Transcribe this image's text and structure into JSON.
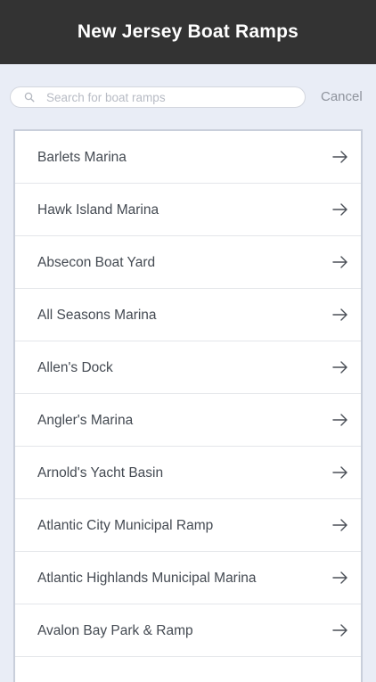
{
  "header": {
    "title": "New Jersey Boat Ramps"
  },
  "search": {
    "placeholder": "Search for boat ramps",
    "value": "",
    "cancel_label": "Cancel"
  },
  "list": {
    "items": [
      {
        "label": "Barlets Marina"
      },
      {
        "label": "Hawk Island Marina"
      },
      {
        "label": "Absecon Boat Yard"
      },
      {
        "label": "All Seasons Marina"
      },
      {
        "label": "Allen's Dock"
      },
      {
        "label": "Angler's Marina"
      },
      {
        "label": "Arnold's Yacht Basin"
      },
      {
        "label": "Atlantic City Municipal Ramp"
      },
      {
        "label": "Atlantic Highlands Municipal Marina"
      },
      {
        "label": "Avalon Bay Park & Ramp"
      },
      {
        "label": ""
      }
    ],
    "item_icon": "arrow-right-icon"
  }
}
